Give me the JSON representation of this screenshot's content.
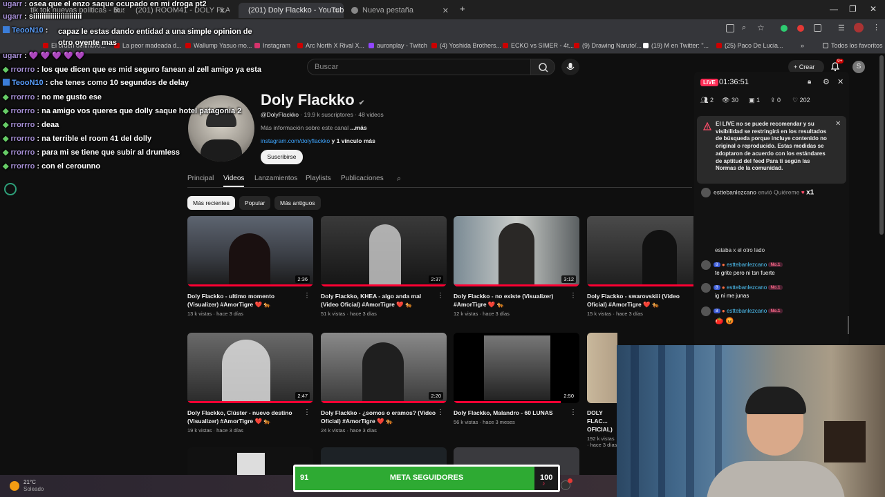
{
  "browser": {
    "tabs": [
      {
        "label": "tik tok nuevas politicas - Buscar"
      },
      {
        "label": "(201) ROOM41 - DOLY FLACKKO"
      },
      {
        "label": "(201) Doly Flackko - YouTube"
      },
      {
        "label": "Nueva pestaña"
      }
    ],
    "bookmarks": [
      "El orden definitivo...",
      "La peor madeada d...",
      "Wallump Yasuo mo...",
      "Instagram",
      "Arc North X Rival X...",
      "auronplay - Twitch",
      "(4) Yoshida Brothers...",
      "ECKO vs SIMER - 4t...",
      "(9) Drawing Naruto/...",
      "(19) M en Twitter: \"...",
      "(25) Paco De Lucia...",
      "Todos los favoritos"
    ]
  },
  "youtube": {
    "search_placeholder": "Buscar",
    "create_label": "Crear",
    "notif_count": "9+",
    "user_initial": "S",
    "channel": {
      "name": "Doly Flackko",
      "handle": "@DolyFlackko",
      "stats": "· 19.9 k suscriptores · 48 videos",
      "about": "Más información sobre este canal",
      "about_more": "...más",
      "link": "instagram.com/dolyflackko",
      "link_more": "y 1 vínculo más",
      "subscribe": "Suscribirse"
    },
    "tabs": [
      "Principal",
      "Videos",
      "Lanzamientos",
      "Playlists",
      "Publicaciones"
    ],
    "chips": [
      "Más recientes",
      "Popular",
      "Más antiguos"
    ],
    "videos": [
      {
        "title": "Doly Flackko - ultimo momento (Visualizer) #AmorTigre ❤️ 🐅",
        "meta": "13 k vistas · hace 3 días",
        "duration": "2:36",
        "progress": 1.0
      },
      {
        "title": "Doly Flackko, KHEA - algo anda mal (Video Oficial) #AmorTigre ❤️ 🐅",
        "meta": "51 k vistas · hace 3 días",
        "duration": "2:37",
        "progress": 1.0
      },
      {
        "title": "Doly Flackko - no existe (Visualizer) #AmorTigre ❤️ 🐅",
        "meta": "12 k vistas · hace 3 días",
        "duration": "3:12",
        "progress": 1.0
      },
      {
        "title": "Doly Flackko - swarovskiii (Video Oficial) #AmorTigre ❤️ 🐅",
        "meta": "15 k vistas · hace 3 días",
        "duration": "",
        "progress": 1.0
      },
      {
        "title": "Doly Flackko, Clúster - nuevo destino (Visualizer) #AmorTigre ❤️ 🐅",
        "meta": "19 k vistas · hace 3 días",
        "duration": "2:47",
        "progress": 1.0
      },
      {
        "title": "Doly Flackko - ¿somos o eramos? (Video Oficial) #AmorTigre ❤️ 🐅",
        "meta": "24 k vistas · hace 3 días",
        "duration": "2:20",
        "progress": 1.0
      },
      {
        "title": "Doly Flackko, Malandro - 60 LUNAS",
        "meta": "56 k vistas · hace 3 meses",
        "duration": "2:50",
        "progress": 0.85
      },
      {
        "title": "DOLY FLAC... OFICIAL)",
        "meta": "192 k vistas · hace 3 días",
        "duration": "",
        "progress": 0
      }
    ]
  },
  "chat": [
    {
      "user": "ugarr",
      "text": "osea que el enzo saque ocupado en mi droga pt2"
    },
    {
      "user": "ugarr",
      "text": "siiiiiiiiiiiiiiiiiiiiiii"
    },
    {
      "user": "TeooN10",
      "text": "capaz le estas dando entidad a una simple opinion de otro oyente mas"
    },
    {
      "user": "ugarr",
      "text": "💜 💜 💜 💜 💜"
    },
    {
      "user": "rrorrro",
      "text": "los que dicen que es mid seguro fanean al zell amigo ya esta"
    },
    {
      "user": "TeooN10",
      "text": "che tenes como 10 segundos de delay"
    },
    {
      "user": "rrorrro",
      "text": "no me gusto ese"
    },
    {
      "user": "rrorrro",
      "text": "na amigo vos queres que dolly saque hotel patagonia 2"
    },
    {
      "user": "rrorrro",
      "text": "deaa"
    },
    {
      "user": "rrorrro",
      "text": "na terrible el room 41 del dolly"
    },
    {
      "user": "rrorrro",
      "text": "para mi se tiene que subir al drumless"
    },
    {
      "user": "rrorrro",
      "text": "con el cerounno"
    }
  ],
  "live": {
    "badge": "LIVE",
    "time": "01:36:51",
    "stats": [
      "2",
      "30",
      "1",
      "0",
      "202"
    ],
    "warning": "El LIVE no se puede recomendar y su visibilidad se restringirá en los resultados de búsqueda porque incluye contenido no original o reproducido. Estas medidas se adoptaron de acuerdo con los estándares de aptitud del feed Para ti según las Normas de la comunidad.",
    "gift": {
      "user": "esttebanlezcano",
      "text": "envió Quiéreme",
      "count": "x1"
    },
    "messages": [
      {
        "user": "",
        "text": "estaba x el otro lado"
      },
      {
        "user": "esttebanlezcano",
        "level": "8",
        "rank": "No.1",
        "text": "te grite pero ni tsn fuerte"
      },
      {
        "user": "esttebanlezcano",
        "level": "8",
        "rank": "No.1",
        "text": "ig ni me junas"
      },
      {
        "user": "esttebanlezcano",
        "level": "8",
        "rank": "No.1",
        "text": "🍅 😡"
      }
    ]
  },
  "weather": {
    "temp": "21°C",
    "desc": "Soleado"
  },
  "goal": {
    "current": "91",
    "label": "META SEGUIDORES",
    "target": "100",
    "fraction": 0.91
  }
}
